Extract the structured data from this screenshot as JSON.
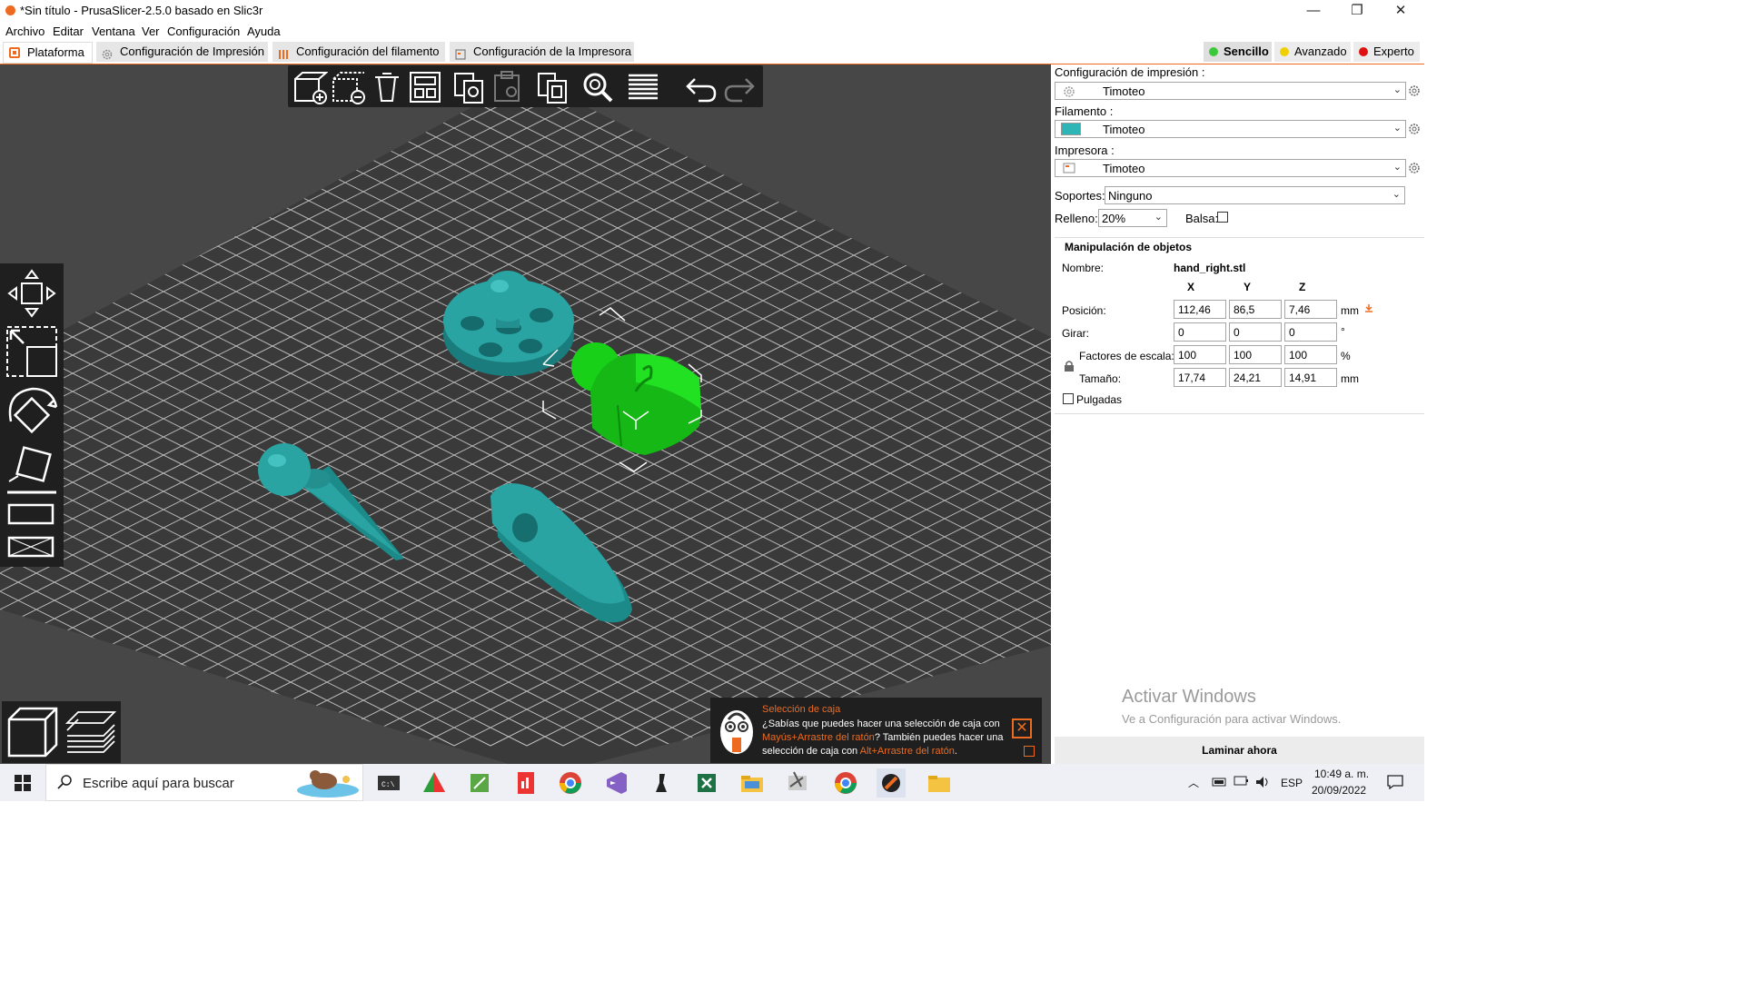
{
  "window": {
    "title": "*Sin título - PrusaSlicer-2.5.0 basado en Slic3r",
    "minimize": "—",
    "maximize": "❐",
    "close": "✕"
  },
  "menu": [
    "Archivo",
    "Editar",
    "Ventana",
    "Ver",
    "Configuración",
    "Ayuda"
  ],
  "tabs": [
    {
      "label": "Plataforma",
      "icon": "platter-icon"
    },
    {
      "label": "Configuración de Impresión",
      "icon": "gear-icon"
    },
    {
      "label": "Configuración del filamento",
      "icon": "filament-icon"
    },
    {
      "label": "Configuración de la Impresora",
      "icon": "printer-icon"
    }
  ],
  "modes": [
    {
      "label": "Sencillo",
      "color": "#3cc83c"
    },
    {
      "label": "Avanzado",
      "color": "#f0d000"
    },
    {
      "label": "Experto",
      "color": "#e01010"
    }
  ],
  "right_panel": {
    "print_label": "Configuración de impresión :",
    "print_value": "Timoteo",
    "filament_label": "Filamento :",
    "filament_value": "Timoteo",
    "filament_color": "#2eb5b5",
    "printer_label": "Impresora :",
    "printer_value": "Timoteo",
    "supports_label": "Soportes:",
    "supports_value": "Ninguno",
    "infill_label": "Relleno:",
    "infill_value": "20%",
    "brim_label": "Balsa:"
  },
  "object_manipulation": {
    "title": "Manipulación de objetos",
    "name_label": "Nombre:",
    "name_value": "hand_right.stl",
    "axes": [
      "X",
      "Y",
      "Z"
    ],
    "position_label": "Posición:",
    "position": [
      "112,46",
      "86,5",
      "7,46"
    ],
    "position_unit": "mm",
    "rotate_label": "Girar:",
    "rotate": [
      "0",
      "0",
      "0"
    ],
    "rotate_unit": "°",
    "scale_label": "Factores de escala:",
    "scale": [
      "100",
      "100",
      "100"
    ],
    "scale_unit": "%",
    "size_label": "Tamaño:",
    "size": [
      "17,74",
      "24,21",
      "14,91"
    ],
    "size_unit": "mm",
    "inches_label": "Pulgadas"
  },
  "watermark": {
    "line1": "Activar Windows",
    "line2": "Ve a Configuración para activar Windows."
  },
  "slice_button": "Laminar ahora",
  "hint": {
    "title": "Selección de caja",
    "text1": "¿Sabías que puedes hacer una selección de caja con ",
    "key1": "Mayús+Arrastre del ratón",
    "text2": "? También puedes hacer una selección de caja con ",
    "key2": "Alt+Arrastre del ratón",
    "text3": "."
  },
  "taskbar": {
    "search_placeholder": "Escribe aquí para buscar",
    "language": "ESP",
    "time": "10:49 a. m.",
    "date": "20/09/2022"
  }
}
